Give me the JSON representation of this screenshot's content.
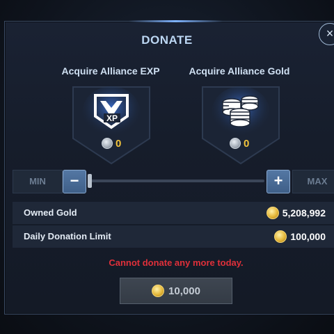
{
  "dialog": {
    "title": "DONATE",
    "close_label": "×"
  },
  "rewards": [
    {
      "label": "Acquire Alliance EXP",
      "icon": "alliance-exp-icon",
      "count": "0"
    },
    {
      "label": "Acquire Alliance Gold",
      "icon": "alliance-gold-coins-icon",
      "count": "0"
    }
  ],
  "stepper": {
    "min_label": "MIN",
    "max_label": "MAX",
    "minus_label": "−",
    "plus_label": "+",
    "fill_fraction": 0
  },
  "stats": [
    {
      "label": "Owned Gold",
      "value": "5,208,992"
    },
    {
      "label": "Daily Donation Limit",
      "value": "100,000"
    }
  ],
  "warning": "Cannot donate any more today.",
  "donate_button": {
    "amount": "10,000"
  },
  "colors": {
    "accent": "#7fb4ff",
    "gold_text": "#f2c43c",
    "warning": "#e0303a"
  }
}
